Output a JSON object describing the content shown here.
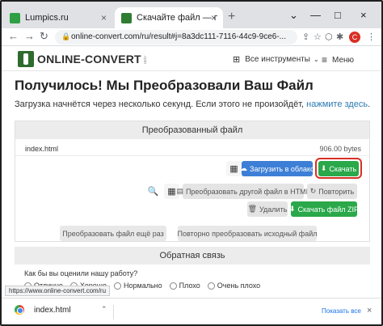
{
  "browser": {
    "tabs": [
      {
        "title": "Lumpics.ru",
        "close": "×"
      },
      {
        "title": "Скачайте файл — преобразовано",
        "close": "×"
      }
    ],
    "new_tab": "+",
    "window_controls": [
      "⌄",
      "—",
      "□",
      "×"
    ],
    "url": "online-convert.com/ru/result#j=8a3dc111-7116-44c9-9ce6-...",
    "avatar_letter": "C",
    "status_url": "https://www.online-convert.com/ru"
  },
  "site": {
    "logo": "ONLINE-CONVERT",
    "logo_small": ".com",
    "tools_label": "Все инструменты",
    "menu_label": "Меню"
  },
  "main": {
    "title": "Получилось! Мы Преобразовали Ваш Файл",
    "subtitle_text": "Загрузка начнётся через несколько секунд. Если этого не произойдёт,",
    "subtitle_link": "нажмите здесь",
    "subtitle_end": "."
  },
  "panel": {
    "header": "Преобразованный файл",
    "file_name": "index.html",
    "file_size": "906.00 bytes",
    "upload_cloud": "Загрузить в облако",
    "download": "Скачать",
    "convert_other": "Преобразовать другой файл в HTML",
    "repeat": "Повторить",
    "delete": "Удалить",
    "download_zip": "Скачать файл ZIP"
  },
  "actions": {
    "convert_again": "Преобразовать файл ещё раз",
    "reconvert_source": "Повторно преобразовать исходный файл"
  },
  "feedback": {
    "header": "Обратная связь",
    "question": "Как бы вы оценили нашу работу?",
    "options": [
      "Отлично",
      "Хорошо",
      "Нормально",
      "Плохо",
      "Очень плохо"
    ]
  },
  "downloads": {
    "file": "index.html",
    "show_all": "Показать все",
    "close": "×"
  },
  "colors": {
    "accent_green": "#2aa84a",
    "accent_blue": "#3d7fd6",
    "highlight_red": "#d93025",
    "link": "#2a7ab0"
  }
}
